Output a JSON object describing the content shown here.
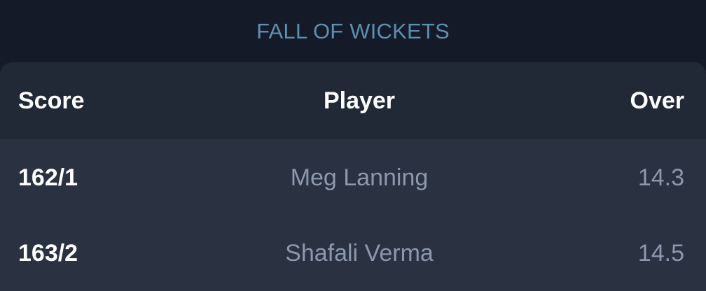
{
  "section": {
    "title": "FALL OF WICKETS"
  },
  "table": {
    "columns": {
      "score": "Score",
      "player": "Player",
      "over": "Over"
    },
    "rows": [
      {
        "score": "162/1",
        "player": "Meg Lanning",
        "over": "14.3"
      },
      {
        "score": "163/2",
        "player": "Shafali Verma",
        "over": "14.5"
      }
    ]
  },
  "colors": {
    "background": "#141a28",
    "card": "#2a3140",
    "header_row": "#222936",
    "title": "#5d8fb0",
    "primary_text": "#ffffff",
    "muted_text": "#8c98ad"
  }
}
